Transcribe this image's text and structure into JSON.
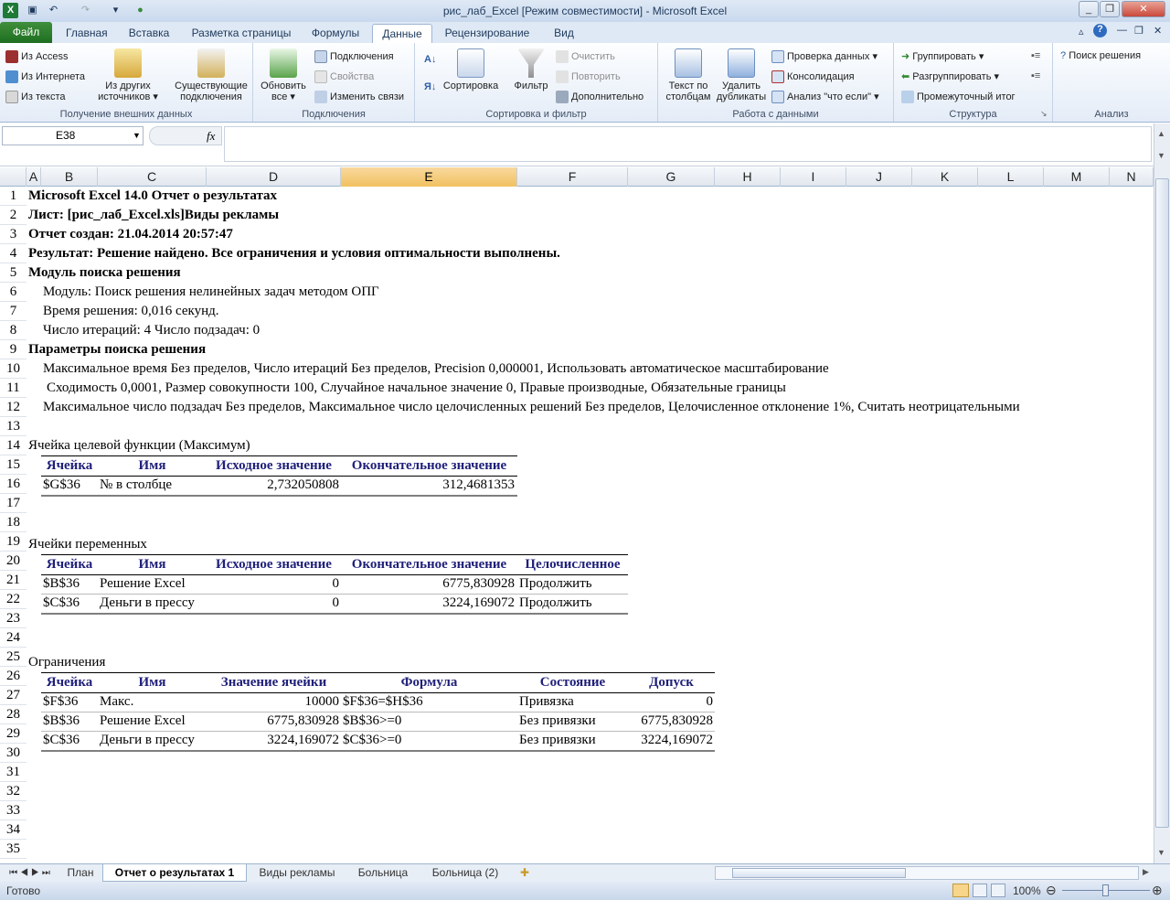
{
  "window": {
    "title": "рис_лаб_Excel  [Режим совместимости]  -  Microsoft Excel"
  },
  "ribbon_tabs": [
    "Файл",
    "Главная",
    "Вставка",
    "Разметка страницы",
    "Формулы",
    "Данные",
    "Рецензирование",
    "Вид"
  ],
  "active_tab": "Данные",
  "ribbon": {
    "ext": {
      "access": "Из Access",
      "web": "Из Интернета",
      "text": "Из текста",
      "other1": "Из других",
      "other2": "источников",
      "exist1": "Существующие",
      "exist2": "подключения",
      "label": "Получение внешних данных"
    },
    "conn": {
      "refresh1": "Обновить",
      "refresh2": "все",
      "connections": "Подключения",
      "props": "Свойства",
      "edit": "Изменить связи",
      "label": "Подключения"
    },
    "sort": {
      "sort": "Сортировка",
      "filter": "Фильтр",
      "clear": "Очистить",
      "reapply": "Повторить",
      "advanced": "Дополнительно",
      "label": "Сортировка и фильтр"
    },
    "tools": {
      "ttc1": "Текст по",
      "ttc2": "столбцам",
      "dup1": "Удалить",
      "dup2": "дубликаты",
      "validate": "Проверка данных",
      "consolidate": "Консолидация",
      "whatif": "Анализ \"что если\"",
      "label": "Работа с данными"
    },
    "outline": {
      "group": "Группировать",
      "ungroup": "Разгруппировать",
      "subtotal": "Промежуточный итог",
      "label": "Структура"
    },
    "analysis": {
      "solver": "Поиск решения",
      "label": "Анализ"
    }
  },
  "namebox": "E38",
  "fx": "fx",
  "columns": [
    "A",
    "B",
    "C",
    "D",
    "E",
    "F",
    "G",
    "H",
    "I",
    "J",
    "K",
    "L",
    "M",
    "N"
  ],
  "selected_column": "E",
  "rows": [
    "1",
    "2",
    "3",
    "4",
    "5",
    "6",
    "7",
    "8",
    "9",
    "10",
    "11",
    "12",
    "13",
    "14",
    "15",
    "16",
    "17",
    "18",
    "19",
    "20",
    "21",
    "22",
    "23",
    "24",
    "25",
    "26",
    "27",
    "28",
    "29",
    "30",
    "31",
    "32",
    "33",
    "34",
    "35"
  ],
  "report": {
    "r1": "Microsoft Excel 14.0 Отчет о результатах",
    "r2": "Лист: [рис_лаб_Excel.xls]Виды рекламы",
    "r3": "Отчет создан: 21.04.2014 20:57:47",
    "r4": "Результат: Решение найдено. Все ограничения и условия оптимальности выполнены.",
    "r5": "Модуль поиска решения",
    "r6": "Модуль: Поиск решения нелинейных задач методом ОПГ",
    "r7": "Время решения: 0,016 секунд.",
    "r8": "Число итераций: 4 Число подзадач: 0",
    "r9": "Параметры поиска решения",
    "r10": "Максимальное время Без пределов,  Число итераций Без пределов, Precision 0,000001, Использовать автоматическое масштабирование",
    "r11": "Сходимость 0,0001, Размер совокупности 100, Случайное начальное значение 0, Правые производные, Обязательные границы",
    "r12": "Максимальное число подзадач Без пределов, Максимальное число целочисленных решений Без пределов, Целочисленное отклонение 1%, Считать неотрицательными",
    "objective": {
      "title": "Ячейка целевой функции (Максимум)",
      "headers": [
        "Ячейка",
        "Имя",
        "Исходное значение",
        "Окончательное значение"
      ],
      "row": [
        "$G$36",
        "№ в столбце",
        "2,732050808",
        "312,4681353"
      ]
    },
    "variables": {
      "title": "Ячейки переменных",
      "headers": [
        "Ячейка",
        "Имя",
        "Исходное значение",
        "Окончательное значение",
        "Целочисленное"
      ],
      "rows": [
        [
          "$B$36",
          "Решение Excel",
          "0",
          "6775,830928",
          "Продолжить"
        ],
        [
          "$C$36",
          "Деньги в прессу",
          "0",
          "3224,169072",
          "Продолжить"
        ]
      ]
    },
    "constraints": {
      "title": "Ограничения",
      "headers": [
        "Ячейка",
        "Имя",
        "Значение ячейки",
        "Формула",
        "Состояние",
        "Допуск"
      ],
      "rows": [
        [
          "$F$36",
          "Макс.",
          "10000",
          "$F$36=$H$36",
          "Привязка",
          "0"
        ],
        [
          "$B$36",
          "Решение Excel",
          "6775,830928",
          "$B$36>=0",
          "Без привязки",
          "6775,830928"
        ],
        [
          "$C$36",
          "Деньги в прессу",
          "3224,169072",
          "$C$36>=0",
          "Без привязки",
          "3224,169072"
        ]
      ]
    }
  },
  "sheet_tabs": [
    "План",
    "Отчет о результатах 1",
    "Виды рекламы",
    "Больница",
    "Больница (2)"
  ],
  "active_sheet": "Отчет о результатах 1",
  "status": {
    "ready": "Готово",
    "zoom": "100%"
  }
}
